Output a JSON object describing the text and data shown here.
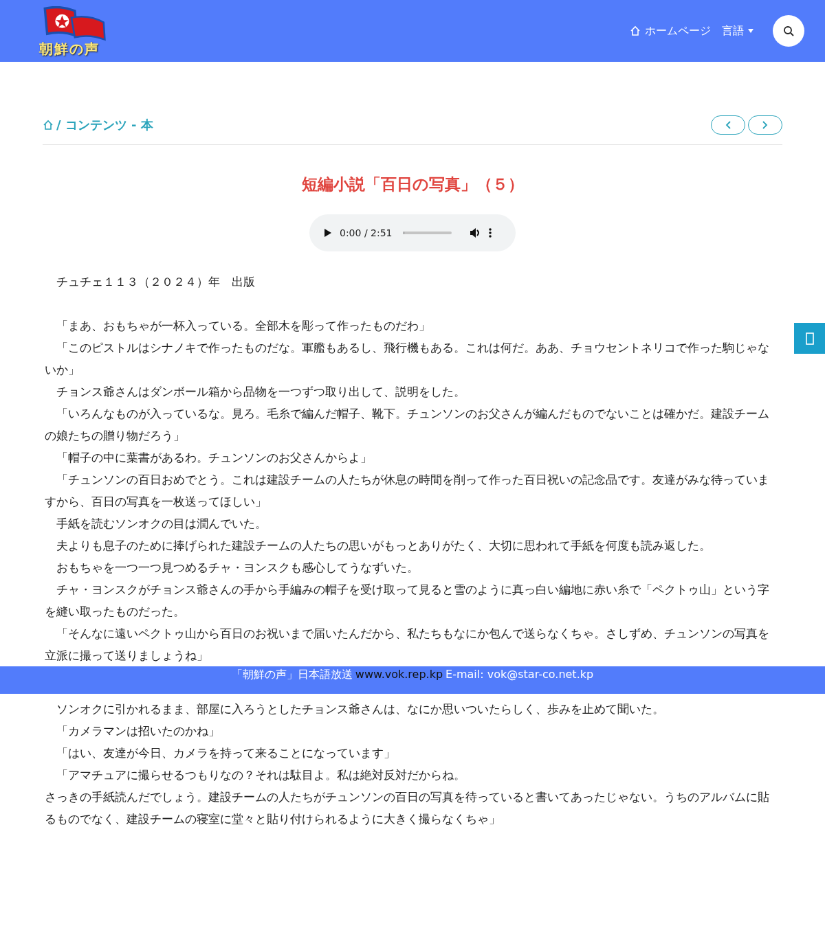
{
  "header": {
    "logo_text": "朝鮮の声",
    "nav": [
      {
        "kind": "home",
        "label": "ホームページ"
      },
      {
        "kind": "dropdown",
        "label": "言語"
      }
    ]
  },
  "breadcrumb": {
    "path": "/ コンテンツ - 本"
  },
  "article": {
    "title": "短編小説「百日の写真」（５）",
    "audio": {
      "time": "0:00 / 2:51",
      "level": 0
    },
    "dateline": "　チュチェ１１３（２０２４）年　出版",
    "paragraphs_before": [
      "　「まあ、おもちゃが一杯入っている。全部木を彫って作ったものだわ」",
      "　「このピストルはシナノキで作ったものだな。軍艦もあるし、飛行機もある。これは何だ。ああ、チョウセントネリコで作った駒じゃないか」",
      "　チョンス爺さんはダンボール箱から品物を一つずつ取り出して、説明をした。",
      "　「いろんなものが入っているな。見ろ。毛糸で編んだ帽子、靴下。チュンソンのお父さんが編んだものでないことは確かだ。建設チームの娘たちの贈り物だろう」",
      "　「帽子の中に葉書があるわ。チュンソンのお父さんからよ」",
      "　「チュンソンの百日おめでとう。これは建設チームの人たちが休息の時間を削って作った百日祝いの記念品です。友達がみな待っていますから、百日の写真を一枚送ってほしい」",
      "　手紙を読むソンオクの目は潤んでいた。",
      "　夫よりも息子のために捧げられた建設チームの人たちの思いがもっとありがたく、大切に思われて手紙を何度も読み返した。",
      "　おもちゃを一つ一つ見つめるチャ・ヨンスクも感心してうなずいた。",
      "　チャ・ヨンスクがチョンス爺さんの手から手編みの帽子を受け取って見ると雪のように真っ白い編地に赤い糸で「ペクトゥ山」という字を縫い取ったものだった。",
      "　「そんなに遠いペクトゥ山から百日のお祝いまで届いたんだから、私たちもなにか包んで送らなくちゃ。さしずめ、チュンソンの写真を立派に撮って送りましょうね」"
    ],
    "paragraphs_after": [
      "　ソンオクに引かれるまま、部屋に入ろうとしたチョンス爺さんは、なにか思いついたらしく、歩みを止めて聞いた。",
      "　「カメラマンは招いたのかね」",
      "　「はい、友達が今日、カメラを持って来ることになっています」",
      "　「アマチュアに撮らせるつもりなの？それは駄目よ。私は絶対反対だからね。",
      "さっきの手紙読んだでしょう。建設チームの人たちがチュンソンの百日の写真を待っていると書いてあったじゃない。うちのアルバムに貼るものでなく、建設チームの寝室に堂々と貼り付けられるように大きく撮らなくちゃ」"
    ]
  },
  "footer": {
    "station": "「朝鮮の声」日本語放送",
    "website": "www.vok.rep.kp",
    "email": "E-mail: vok@star-co.net.kp"
  }
}
